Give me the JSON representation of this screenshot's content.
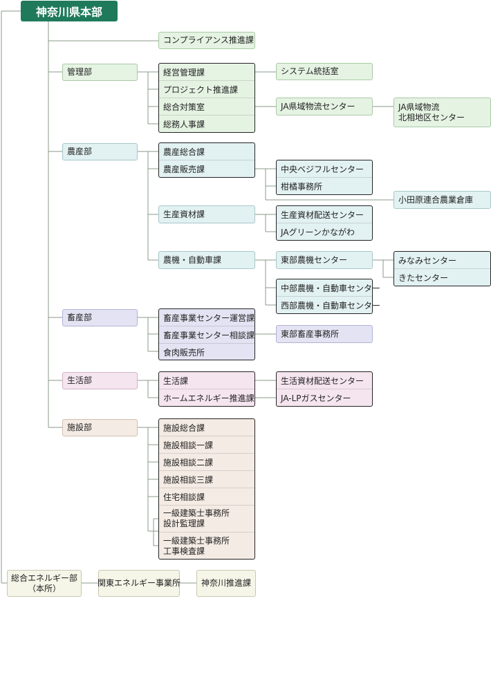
{
  "title": "神奈川県本部",
  "compliance": "コンプライアンス推進課",
  "kanri": {
    "dept": "管理部",
    "sections": [
      "経営管理課",
      "プロジェクト推進課",
      "総合対策室",
      "総務人事課"
    ],
    "system": "システム統括室",
    "logistics": "JA県域物流センター",
    "logistics_north": "JA県域物流\n北相地区センター"
  },
  "nousan": {
    "dept": "農産部",
    "sections": [
      "農産総合課",
      "農産販売課"
    ],
    "centers": [
      "中央ベジフルセンター",
      "柑橘事務所"
    ],
    "odawara": "小田原連合農業倉庫",
    "shizai": "生産資材課",
    "shizai_centers": [
      "生産資材配送センター",
      "JAグリーンかながわ"
    ],
    "nouki": "農機・自動車課",
    "toubu": "東部農機センター",
    "toubu_sub": [
      "みなみセンター",
      "きたセンター"
    ],
    "nouki_centers": [
      "中部農機・自動車センター",
      "西部農機・自動車センター"
    ]
  },
  "chikusan": {
    "dept": "畜産部",
    "sections": [
      "畜産事業センター運営課",
      "畜産事業センター相談課",
      "食肉販売所"
    ],
    "office": "東部畜産事務所"
  },
  "seikatsu": {
    "dept": "生活部",
    "sections": [
      "生活課",
      "ホームエネルギー推進課"
    ],
    "centers": [
      "生活資材配送センター",
      "JA-LPガスセンター"
    ]
  },
  "shisetsu": {
    "dept": "施設部",
    "sections": [
      "施設総合課",
      "施設相談一課",
      "施設相談二課",
      "施設相談三課",
      "住宅相談課",
      "一級建築士事務所\n設計監理課",
      "一級建築士事務所\n工事検査課"
    ]
  },
  "energy": {
    "dept": "総合エネルギー部\n（本所）",
    "office": "関東エネルギー事業所",
    "section": "神奈川推進課"
  }
}
